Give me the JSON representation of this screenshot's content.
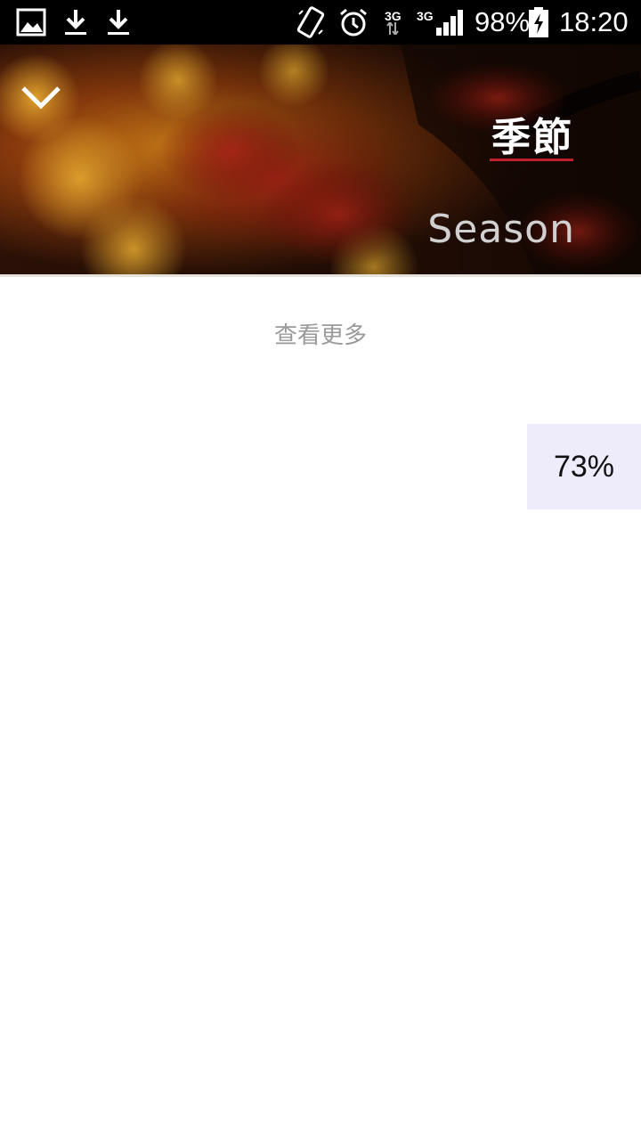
{
  "status_bar": {
    "left_icons": [
      "gallery-icon",
      "download-icon",
      "download-icon"
    ],
    "right_icons": [
      "vibrate-icon",
      "alarm-icon",
      "network-3g-icon",
      "signal-icon",
      "battery-charging-icon"
    ],
    "network_primary": "3G",
    "network_secondary": "3G",
    "battery": "98%",
    "time": "18:20"
  },
  "hero": {
    "collapse_icon": "chevron-down-icon",
    "title_cn": "季節",
    "title_en": "Season",
    "accent_color": "#c0202a"
  },
  "main": {
    "see_more": "查看更多"
  },
  "progress_badge": {
    "label": "73%",
    "value": 0.73
  }
}
